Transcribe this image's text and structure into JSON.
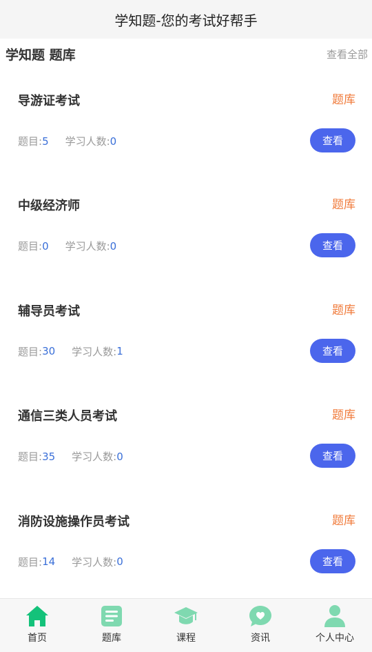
{
  "header": {
    "title": "学知题-您的考试好帮手"
  },
  "section": {
    "title": "学知题 题库",
    "view_all": "查看全部"
  },
  "labels": {
    "questions": "题目:",
    "learners": "学习人数:",
    "tag": "题库",
    "view": "查看"
  },
  "banks": [
    {
      "name": "导游证考试",
      "questions": "5",
      "learners": "0"
    },
    {
      "name": "中级经济师",
      "questions": "0",
      "learners": "0"
    },
    {
      "name": "辅导员考试",
      "questions": "30",
      "learners": "1"
    },
    {
      "name": "通信三类人员考试",
      "questions": "35",
      "learners": "0"
    },
    {
      "name": "消防设施操作员考试",
      "questions": "14",
      "learners": "0"
    }
  ],
  "tabbar": {
    "accent_color": "#14c27a",
    "inactive_color": "#7fd9b0",
    "items": [
      {
        "label": "首页",
        "icon": "home-icon",
        "active": true
      },
      {
        "label": "题库",
        "icon": "list-icon",
        "active": false
      },
      {
        "label": "课程",
        "icon": "graduation-cap-icon",
        "active": false
      },
      {
        "label": "资讯",
        "icon": "heart-chat-icon",
        "active": false
      },
      {
        "label": "个人中心",
        "icon": "user-icon",
        "active": false
      }
    ]
  }
}
